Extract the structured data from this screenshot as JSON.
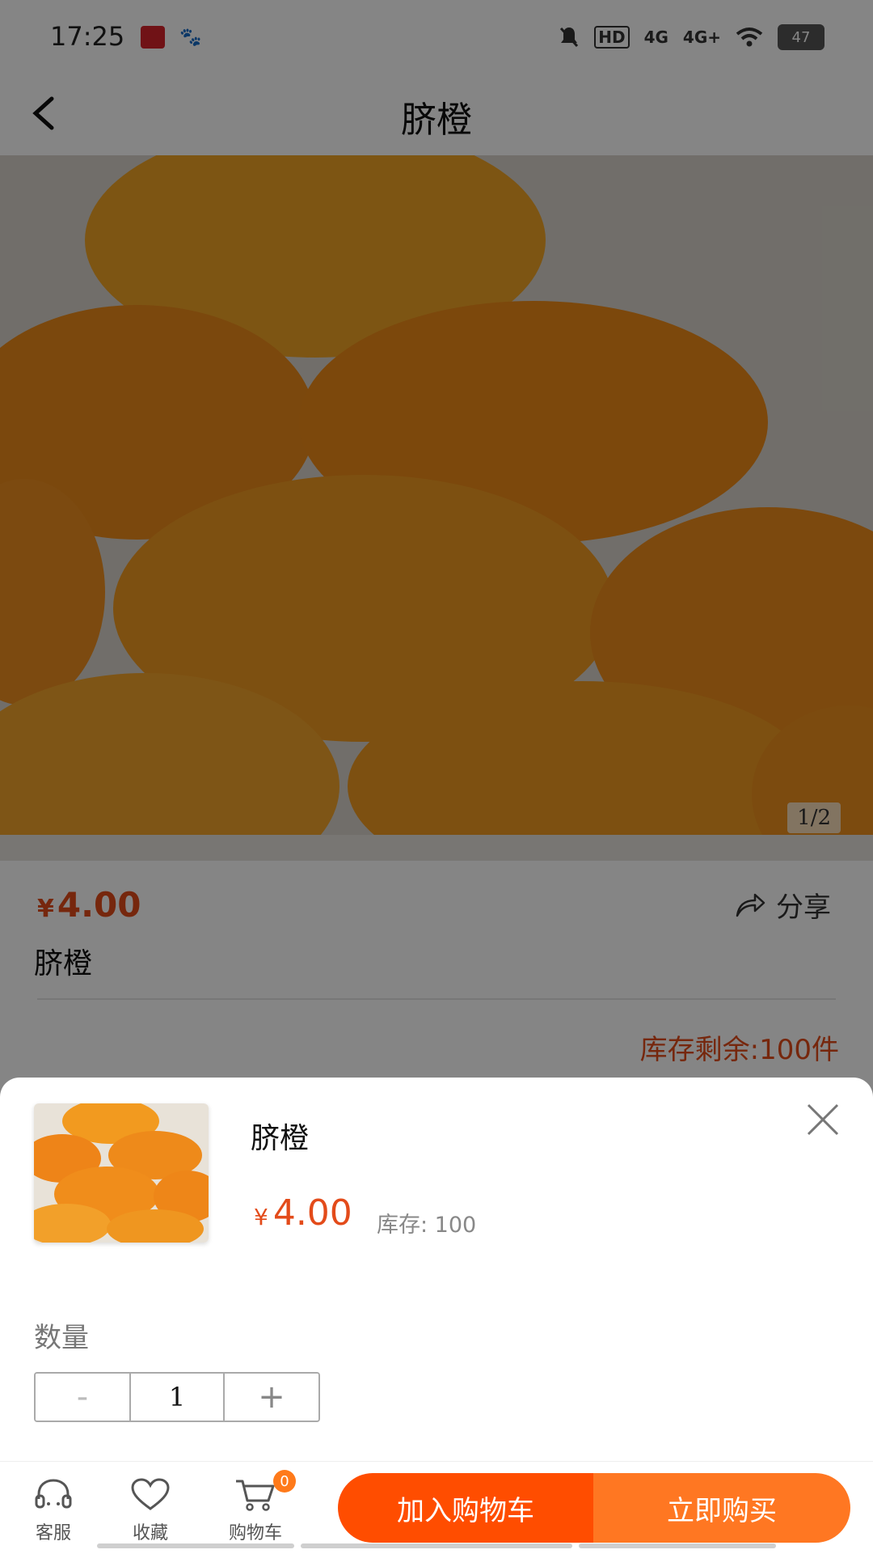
{
  "status_bar": {
    "time": "17:25",
    "network_hd": "HD",
    "network_1": "4G",
    "network_2": "4G+",
    "battery": "47"
  },
  "header": {
    "title": "脐橙"
  },
  "gallery": {
    "counter": "1/2"
  },
  "product": {
    "currency": "¥",
    "price": "4.00",
    "name": "脐橙",
    "share_label": "分享",
    "stock_remaining": "库存剩余:100件"
  },
  "sheet": {
    "name": "脐橙",
    "currency": "¥",
    "price": "4.00",
    "stock": "库存: 100",
    "quantity_label": "数量",
    "minus_label": "-",
    "quantity_value": "1",
    "plus_label": "+"
  },
  "bottom_bar": {
    "service_label": "客服",
    "favorite_label": "收藏",
    "cart_label": "购物车",
    "cart_count": "0",
    "add_to_cart_label": "加入购物车",
    "buy_now_label": "立即购买"
  },
  "colors": {
    "accent_red": "#e34b1a",
    "add_button": "#ff4d00",
    "buy_button": "#ff7722"
  }
}
